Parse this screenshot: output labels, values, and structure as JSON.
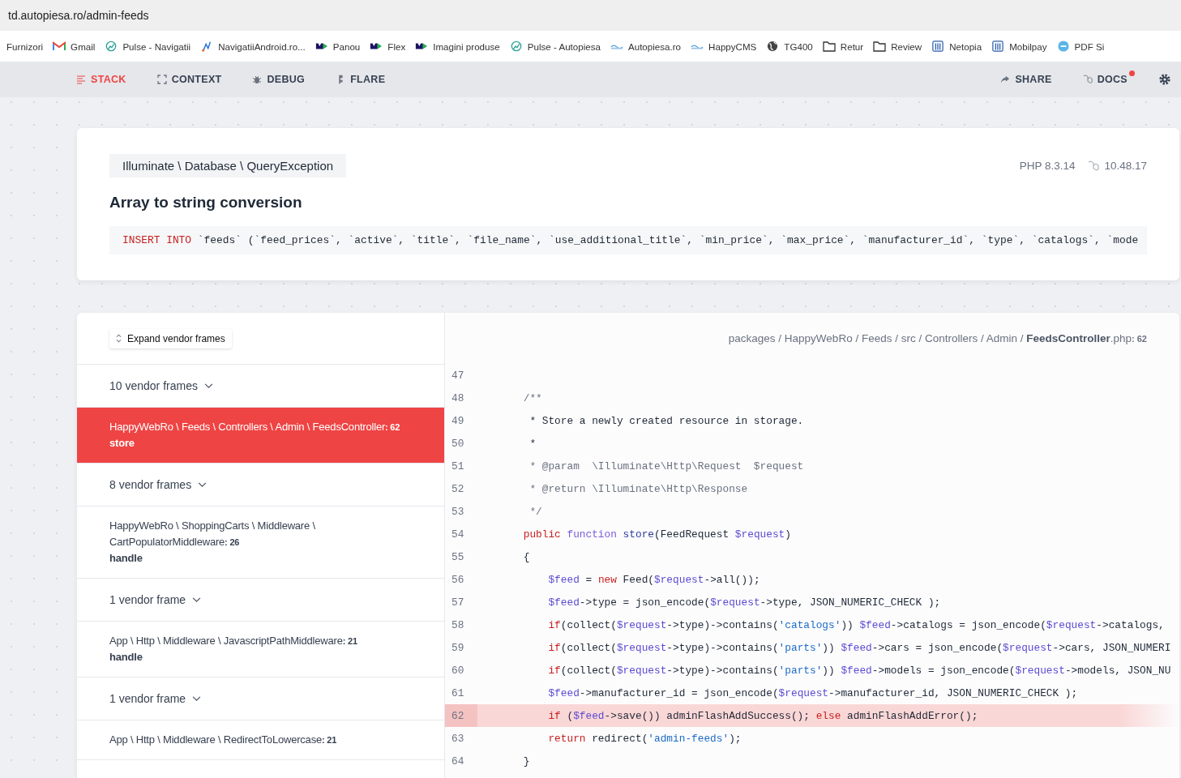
{
  "browser": {
    "url": "td.autopiesa.ro/admin-feeds",
    "bookmarks": [
      {
        "label": "Furnizori",
        "kind": "plain"
      },
      {
        "label": "Gmail",
        "kind": "mail"
      },
      {
        "label": "Pulse - Navigatii",
        "kind": "gauge"
      },
      {
        "label": "NavigatiiAndroid.ro...",
        "kind": "pin"
      },
      {
        "label": "Panou",
        "kind": "mlogo"
      },
      {
        "label": "Flex",
        "kind": "mlogo"
      },
      {
        "label": "Imagini produse",
        "kind": "mlogo"
      },
      {
        "label": "Pulse - Autopiesa",
        "kind": "gauge"
      },
      {
        "label": "Autopiesa.ro",
        "kind": "wave"
      },
      {
        "label": "HappyCMS",
        "kind": "wave"
      },
      {
        "label": "TG400",
        "kind": "globe"
      },
      {
        "label": "Retur",
        "kind": "folder"
      },
      {
        "label": "Review",
        "kind": "folder"
      },
      {
        "label": "Netopia",
        "kind": "bars"
      },
      {
        "label": "Mobilpay",
        "kind": "bars"
      },
      {
        "label": "PDF Si",
        "kind": "circle"
      }
    ]
  },
  "nav": {
    "tabs": [
      {
        "label": "STACK",
        "kind": "stack",
        "selected": true
      },
      {
        "label": "CONTEXT",
        "kind": "context",
        "selected": false
      },
      {
        "label": "DEBUG",
        "kind": "bug",
        "selected": false
      },
      {
        "label": "FLARE",
        "kind": "flare",
        "selected": false
      }
    ],
    "actions": [
      {
        "label": "SHARE",
        "kind": "share",
        "badge": false
      },
      {
        "label": "DOCS",
        "kind": "docs",
        "badge": true
      }
    ]
  },
  "exception": {
    "class": "Illuminate \\ Database \\ QueryException",
    "php": "PHP 8.3.14",
    "laravel": "10.48.17",
    "message": "Array to string conversion",
    "sql": [
      {
        "kind": "keyword",
        "text": "INSERT INTO"
      },
      {
        "kind": "plain",
        "text": " `feeds` (`feed_prices`, `active`, `title`, `file_name`, `use_additional_title`, `min_price`, `max_price`, `manufacturer_id`, `type`, `catalogs`, `mode"
      }
    ]
  },
  "frames": {
    "expand_button": "Expand vendor frames",
    "items": [
      {
        "kind": "vendor",
        "label": "10 vendor frames"
      },
      {
        "kind": "app",
        "class": "HappyWebRo \\ Feeds \\ Controllers \\ Admin \\ FeedsController",
        "line": ": 62",
        "method": "store",
        "selected": true
      },
      {
        "kind": "vendor",
        "label": "8 vendor frames"
      },
      {
        "kind": "app",
        "class": "HappyWebRo \\ ShoppingCarts \\ Middleware \\ CartPopulatorMiddleware",
        "line": ": 26",
        "method": "handle",
        "selected": false
      },
      {
        "kind": "vendor",
        "label": "1 vendor frame"
      },
      {
        "kind": "app",
        "class": "App \\ Http \\ Middleware \\ JavascriptPathMiddleware",
        "line": ": 21",
        "method": "handle",
        "selected": false
      },
      {
        "kind": "vendor",
        "label": "1 vendor frame"
      },
      {
        "kind": "app",
        "class": "App \\ Http \\ Middleware \\ RedirectToLowercase",
        "line": ": 21",
        "selected": false
      }
    ]
  },
  "code": {
    "path": "packages / HappyWebRo / Feeds / src / Controllers / Admin / **FeedsController**.php",
    "line": ": 62",
    "lines": [
      {
        "number": "47",
        "highlighted": false
      },
      {
        "number": "48",
        "highlighted": false,
        "tokens": [
          {
            "kind": "comment",
            "text": "    /**"
          }
        ]
      },
      {
        "number": "49",
        "highlighted": false,
        "tokens": [
          {
            "kind": "plain",
            "text": "     * Store a newly created resource in storage."
          }
        ]
      },
      {
        "number": "50",
        "highlighted": false,
        "tokens": [
          {
            "kind": "plain",
            "text": "     *"
          }
        ]
      },
      {
        "number": "51",
        "highlighted": false,
        "tokens": [
          {
            "kind": "comment",
            "text": "     * @param  \\Illuminate\\Http\\Request  $request"
          }
        ]
      },
      {
        "number": "52",
        "highlighted": false,
        "tokens": [
          {
            "kind": "comment",
            "text": "     * @return \\Illuminate\\Http\\Response"
          }
        ]
      },
      {
        "number": "53",
        "highlighted": false,
        "tokens": [
          {
            "kind": "comment",
            "text": "     */"
          }
        ]
      },
      {
        "number": "54",
        "highlighted": false,
        "tokens": [
          {
            "kind": "keyword",
            "text": "    public"
          },
          {
            "kind": "keyword2",
            "text": " function"
          },
          {
            "kind": "function",
            "text": " store"
          },
          {
            "kind": "plain",
            "text": "(FeedRequest "
          },
          {
            "kind": "variable",
            "text": "$request"
          },
          {
            "kind": "plain",
            "text": ")"
          }
        ]
      },
      {
        "number": "55",
        "highlighted": false,
        "tokens": [
          {
            "kind": "plain",
            "text": "    {"
          }
        ]
      },
      {
        "number": "56",
        "highlighted": false,
        "tokens": [
          {
            "kind": "variable",
            "text": "        $feed"
          },
          {
            "kind": "plain",
            "text": " = "
          },
          {
            "kind": "keyword",
            "text": "new"
          },
          {
            "kind": "plain",
            "text": " Feed("
          },
          {
            "kind": "variable",
            "text": "$request"
          },
          {
            "kind": "plain",
            "text": "->all());"
          }
        ]
      },
      {
        "number": "57",
        "highlighted": false,
        "tokens": [
          {
            "kind": "variable",
            "text": "        $feed"
          },
          {
            "kind": "plain",
            "text": "->type = json_encode("
          },
          {
            "kind": "variable",
            "text": "$request"
          },
          {
            "kind": "plain",
            "text": "->type, JSON_NUMERIC_CHECK );"
          }
        ]
      },
      {
        "number": "58",
        "highlighted": false,
        "tokens": [
          {
            "kind": "keyword",
            "text": "        if"
          },
          {
            "kind": "plain",
            "text": "(collect("
          },
          {
            "kind": "variable",
            "text": "$request"
          },
          {
            "kind": "plain",
            "text": "->type)->contains("
          },
          {
            "kind": "string",
            "text": "'catalogs'"
          },
          {
            "kind": "plain",
            "text": ")) "
          },
          {
            "kind": "variable",
            "text": "$feed"
          },
          {
            "kind": "plain",
            "text": "->catalogs = json_encode("
          },
          {
            "kind": "variable",
            "text": "$request"
          },
          {
            "kind": "plain",
            "text": "->catalogs,"
          }
        ]
      },
      {
        "number": "59",
        "highlighted": false,
        "tokens": [
          {
            "kind": "keyword",
            "text": "        if"
          },
          {
            "kind": "plain",
            "text": "(collect("
          },
          {
            "kind": "variable",
            "text": "$request"
          },
          {
            "kind": "plain",
            "text": "->type)->contains("
          },
          {
            "kind": "string",
            "text": "'parts'"
          },
          {
            "kind": "plain",
            "text": ")) "
          },
          {
            "kind": "variable",
            "text": "$feed"
          },
          {
            "kind": "plain",
            "text": "->cars = json_encode("
          },
          {
            "kind": "variable",
            "text": "$request"
          },
          {
            "kind": "plain",
            "text": "->cars, JSON_NUMERI"
          }
        ]
      },
      {
        "number": "60",
        "highlighted": false,
        "tokens": [
          {
            "kind": "keyword",
            "text": "        if"
          },
          {
            "kind": "plain",
            "text": "(collect("
          },
          {
            "kind": "variable",
            "text": "$request"
          },
          {
            "kind": "plain",
            "text": "->type)->contains("
          },
          {
            "kind": "string",
            "text": "'parts'"
          },
          {
            "kind": "plain",
            "text": ")) "
          },
          {
            "kind": "variable",
            "text": "$feed"
          },
          {
            "kind": "plain",
            "text": "->models = json_encode("
          },
          {
            "kind": "variable",
            "text": "$request"
          },
          {
            "kind": "plain",
            "text": "->models, JSON_NU"
          }
        ]
      },
      {
        "number": "61",
        "highlighted": false,
        "tokens": [
          {
            "kind": "variable",
            "text": "        $feed"
          },
          {
            "kind": "plain",
            "text": "->manufacturer_id = json_encode("
          },
          {
            "kind": "variable",
            "text": "$request"
          },
          {
            "kind": "plain",
            "text": "->manufacturer_id, JSON_NUMERIC_CHECK );"
          }
        ]
      },
      {
        "number": "62",
        "highlighted": true,
        "tokens": [
          {
            "kind": "keyword",
            "text": "        if"
          },
          {
            "kind": "plain",
            "text": " ("
          },
          {
            "kind": "variable",
            "text": "$feed"
          },
          {
            "kind": "plain",
            "text": "->save()) adminFlashAddSuccess(); "
          },
          {
            "kind": "keyword",
            "text": "else"
          },
          {
            "kind": "plain",
            "text": " adminFlashAddError();"
          }
        ]
      },
      {
        "number": "63",
        "highlighted": false,
        "tokens": [
          {
            "kind": "keyword",
            "text": "        return"
          },
          {
            "kind": "plain",
            "text": " redirect("
          },
          {
            "kind": "string",
            "text": "'admin-feeds'"
          },
          {
            "kind": "plain",
            "text": ");"
          }
        ]
      },
      {
        "number": "64",
        "highlighted": false,
        "tokens": [
          {
            "kind": "plain",
            "text": "    }"
          }
        ]
      }
    ]
  }
}
